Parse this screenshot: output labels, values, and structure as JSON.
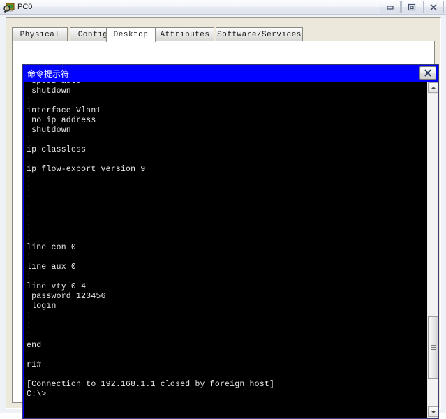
{
  "window": {
    "title": "PC0",
    "icon": "pc-magnifier-icon",
    "buttons": {
      "minimize": "minimize-icon",
      "restore": "restore-icon",
      "close": "close-icon"
    }
  },
  "tabs": [
    {
      "label": "Physical",
      "active": false
    },
    {
      "label": "Config",
      "active": false
    },
    {
      "label": "Desktop",
      "active": true
    },
    {
      "label": "Attributes",
      "active": false
    },
    {
      "label": "Software/Services",
      "active": false
    }
  ],
  "command_prompt": {
    "title": "命令提示符",
    "close_label": "X",
    "scrollbar": {
      "up_arrow": "scroll-up-icon",
      "down_arrow": "scroll-down-icon"
    },
    "terminal_lines": [
      " speed auto",
      " shutdown",
      "!",
      "interface Vlan1",
      " no ip address",
      " shutdown",
      "!",
      "ip classless",
      "!",
      "ip flow-export version 9",
      "!",
      "!",
      "!",
      "!",
      "!",
      "!",
      "!",
      "line con 0",
      "!",
      "line aux 0",
      "!",
      "line vty 0 4",
      " password 123456",
      " login",
      "!",
      "!",
      "!",
      "end",
      "",
      "r1#",
      "",
      "[Connection to 192.168.1.1 closed by foreign host]",
      "C:\\>"
    ]
  },
  "colors": {
    "titlebar_accent": "#0000ff",
    "terminal_bg": "#000000",
    "terminal_fg": "#e8e8e8",
    "panel_bg": "#ece9dc"
  }
}
